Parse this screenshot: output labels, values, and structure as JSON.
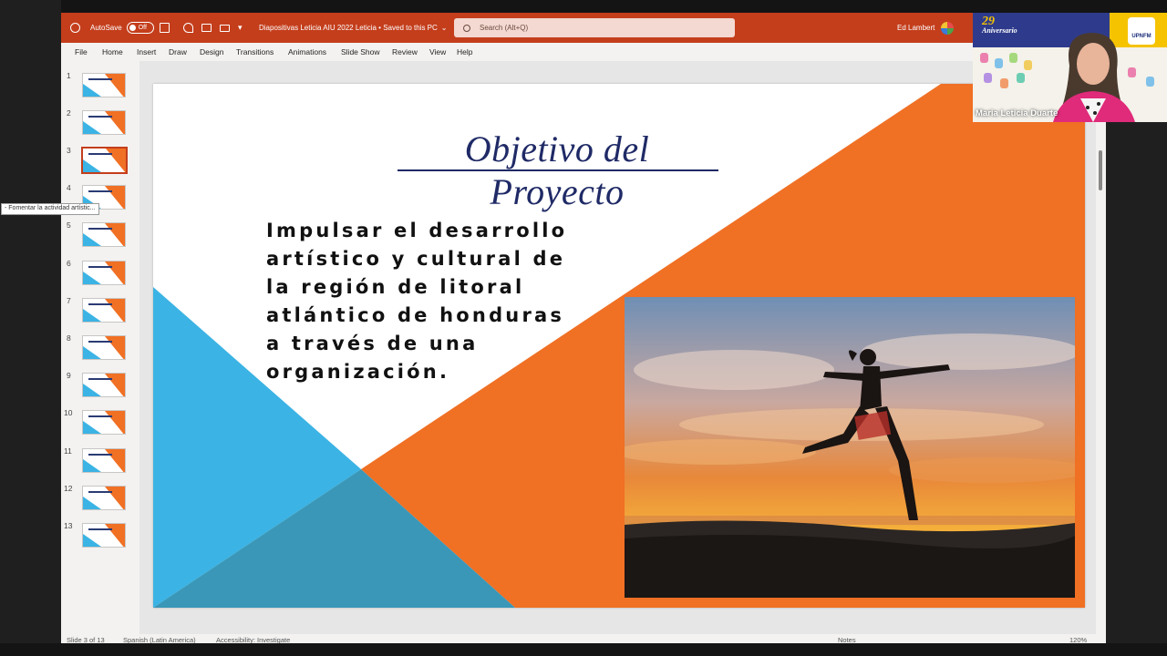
{
  "titlebar": {
    "autosave_label": "AutoSave",
    "autosave_state": "Off",
    "doc_title": "Diapositivas Leticia AIU 2022 Leticia • Saved to this PC",
    "search_placeholder": "Search (Alt+Q)",
    "user_name": "Ed Lambert"
  },
  "menu": [
    "File",
    "Home",
    "Insert",
    "Draw",
    "Design",
    "Transitions",
    "Animations",
    "Slide Show",
    "Review",
    "View",
    "Help"
  ],
  "thumbnails": {
    "numbers": [
      "1",
      "2",
      "3",
      "4",
      "5",
      "6",
      "7",
      "8",
      "9",
      "10",
      "11",
      "12",
      "13"
    ],
    "selected": 3,
    "tooltip": "- Fomentar la actividad artístic..."
  },
  "slide": {
    "title": "Objetivo del Proyecto",
    "body_lines": [
      "Impulsar el desarrollo",
      "artístico y cultural de",
      "la región de litoral",
      "atlántico de honduras",
      "a través de una",
      "organización."
    ],
    "colors": {
      "orange": "#f07024",
      "blue": "#3bb3e4",
      "dark_blue": "#3a97b8",
      "title": "#1f2a66"
    }
  },
  "statusbar": {
    "slide_info": "Slide 3 of 13",
    "language": "Spanish (Latin America)",
    "accessibility": "Accessibility: Investigate",
    "notes": "Notes",
    "zoom": "120%"
  },
  "video": {
    "participant_name": "Maria Leticia Duarte",
    "anniversary_number": "29",
    "anniversary_label": "Aniversario",
    "logo_text": "UPNFM"
  }
}
